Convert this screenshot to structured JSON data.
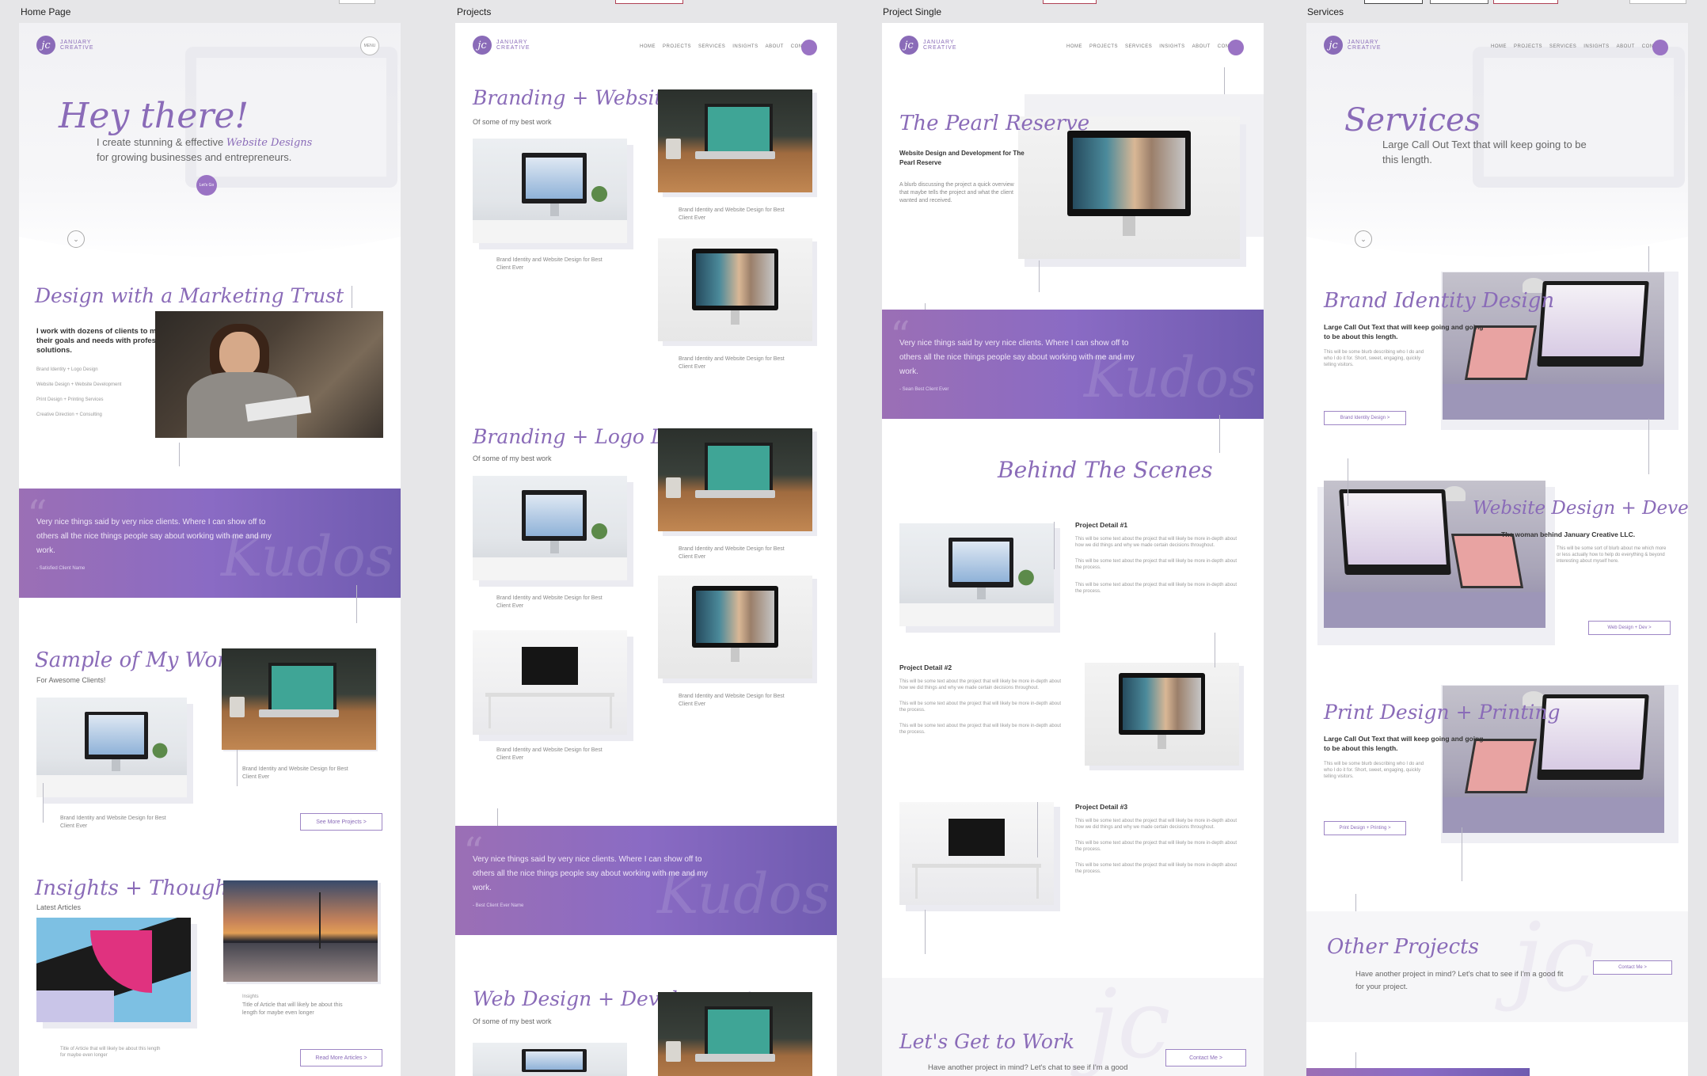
{
  "boards": {
    "home": "Home Page",
    "projects": "Projects",
    "single": "Project Single",
    "services": "Services"
  },
  "logo": {
    "mark": "jc",
    "line1": "JANUARY",
    "line2": "CREATIVE"
  },
  "nav": [
    "HOME",
    "PROJECTS",
    "SERVICES",
    "INSIGHTS",
    "ABOUT",
    "CONTACT"
  ],
  "menu": "MENU",
  "home": {
    "hero_title": "Hey there!",
    "hero_line1_a": "I create stunning & effective",
    "hero_line1_script": "Website Designs",
    "hero_line2": "for growing businesses and entrepreneurs.",
    "hero_btn": "Let's Go",
    "trust_title": "Design with a Marketing Trust",
    "trust_body": "I work with dozens of clients to meet and exceed their goals and needs with professional design solutions.",
    "trust_list": [
      "Brand Identity + Logo Design",
      "Website Design + Website Development",
      "Print Design + Printing Services",
      "Creative Direction + Consulting"
    ],
    "kudos_quote": "Very nice things said by very nice clients. Where I can show off to others all the nice things people say about working with me and my work.",
    "kudos_author": "- Satisfied Client Name",
    "kudos_word": "Kudos",
    "sample_title": "Sample of My Work",
    "sample_sub": "For Awesome Clients!",
    "caption1": "Brand Identity and Website Design for Best Client Ever",
    "caption2": "Brand Identity and Website Design for Best Client Ever",
    "see_more": "See More Projects >",
    "insights_title": "Insights + Thoughts",
    "insights_sub": "Latest Articles",
    "article_cat": "Insights",
    "article_title": "Title of Article that will likely be about this length for maybe even longer",
    "article_title2": "Title of Article that will likely be about this length for maybe even longer",
    "read_more": "Read More Articles >"
  },
  "projects": {
    "s1_title": "Branding + Websites",
    "s1_sub": "Of some of my best work",
    "s2_title": "Branding + Logo Design",
    "s2_sub": "Of some of my best work",
    "s3_title": "Web Design + Development",
    "s3_sub": "Of some of my best work",
    "caption": "Brand Identity and Website Design for Best Client Ever",
    "kudos_quote": "Very nice things said by very nice clients. Where I can show off to others all the nice things people say about working with me and my work.",
    "kudos_author": "- Best Client Ever Name",
    "kudos_word": "Kudos"
  },
  "single": {
    "title": "The Pearl Reserve",
    "subtitle": "Website Design and Development for The Pearl Reserve",
    "blurb": "A blurb discussing the project a quick overview that maybe tells the project and what the client wanted and received.",
    "kudos_quote": "Very nice things said by very nice clients. Where I can show off to others all the nice things people say about working with me and my work.",
    "kudos_author": "- Sean Best Client Ever",
    "kudos_word": "Kudos",
    "bts_title": "Behind The Scenes",
    "detail1": "Project Detail #1",
    "detail2": "Project Detail #2",
    "detail3": "Project Detail #3",
    "detail_p1": "This will be some text about the project that will likely be more in-depth about how we did things and why we made certain decisions throughout.",
    "detail_p2": "This will be some text about the project that will likely be more in-depth about the process.",
    "cta_title": "Let's Get to Work",
    "cta_body": "Have another project in mind? Let's chat to see if I'm a good fit for your project.",
    "cta_btn": "Contact Me >"
  },
  "services": {
    "title": "Services",
    "callout": "Large Call Out Text that will keep going to be this length.",
    "svc1_title": "Brand Identity Design",
    "svc1_callout": "Large Call Out Text that will keep going and going to be about this length.",
    "svc1_body": "This will be some blurb describing who I do and who I do it for. Short, sweet, engaging, quickly telling visitors.",
    "svc1_btn": "Brand Identity Design >",
    "svc2_title": "Website Design + Development",
    "svc2_callout": "The woman behind January Creative LLC.",
    "svc2_body": "This will be some sort of blurb about me which more or less actually how to help do everything & beyond interesting about myself here.",
    "svc2_btn": "Web Design + Dev >",
    "svc3_title": "Print Design + Printing",
    "svc3_callout": "Large Call Out Text that will keep going and going to be about this length.",
    "svc3_body": "This will be some blurb describing who I do and who I do it for. Short, sweet, engaging, quickly telling visitors.",
    "svc3_btn": "Print Design + Printing >",
    "other_title": "Other Projects",
    "other_body": "Have another project in mind? Let's chat to see if I'm a good fit for your project.",
    "other_btn": "Contact Me >"
  }
}
